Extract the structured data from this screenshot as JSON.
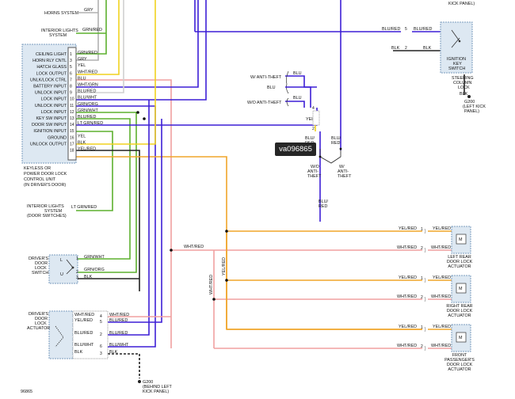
{
  "image_ref": "96865",
  "stamp": "va096865",
  "top_right_frag": "KICK PANEL)",
  "left_systems": {
    "horns": "HORNS SYSTEM",
    "horns_wire": "GRY",
    "interior_1": "INTERIOR LIGHTS",
    "interior_2": "SYSTEM",
    "interior_wire": "GRN/RED"
  },
  "module": {
    "caption": [
      "KEYLESS OR",
      "POWER DOOR LOCK",
      "CONTROL UNIT",
      "(IN DRIVER'S DOOR)"
    ],
    "pins": [
      {
        "n": "1",
        "label": "CEILING LIGHT",
        "wire": "GRN/RED"
      },
      {
        "n": "3",
        "label": "HORN RLY CNTL",
        "wire": "GRY"
      },
      {
        "n": "5",
        "label": "HATCH GLASS",
        "wire": "YEL"
      },
      {
        "n": "6",
        "label": "LOCK OUTPUT",
        "wire": "WHT/RED"
      },
      {
        "n": "7",
        "label": "UNLK/LOCK CTRL",
        "wire": "BLU"
      },
      {
        "n": "8",
        "label": "BATTERY INPUT",
        "wire": "WHT/GRN"
      },
      {
        "n": "9",
        "label": "UNLOCK INPUT",
        "wire": "BLU/RED"
      },
      {
        "n": "10",
        "label": "LOCK INPUT",
        "wire": "BLU/WHT"
      },
      {
        "n": "11",
        "label": "UNLOCK INPUT",
        "wire": "GRN/ORG"
      },
      {
        "n": "12",
        "label": "LOCK INPUT",
        "wire": "GRN/WHT"
      },
      {
        "n": "13",
        "label": "KEY SW INPUT",
        "wire": "BLU/RED"
      },
      {
        "n": "14",
        "label": "DOOR SW INPUT",
        "wire": "LT GRN/RED"
      },
      {
        "n": "15",
        "label": "IGNITION INPUT",
        "wire": ""
      },
      {
        "n": "16",
        "label": "GROUND",
        "wire": "YEL"
      },
      {
        "n": "17",
        "label": "UNLOCK OUTPUT",
        "wire": "BLK"
      },
      {
        "n": "18",
        "label": "",
        "wire": "YEL/RED"
      }
    ]
  },
  "interior_door": {
    "l1": "INTERIOR LIGHTS",
    "l2": "SYSTEM",
    "l3": "(DOOR SWITCHES)",
    "wire": "LT GRN/RED"
  },
  "door_lock_switch": {
    "l1": "DRIVER'S",
    "l2": "DOOR",
    "l3": "LOCK",
    "l4": "SWITCH",
    "L": "L",
    "U": "U",
    "pins": [
      "1",
      "2",
      "3"
    ],
    "wires": [
      "GRN/WHT",
      "GRN/ORG",
      "BLK"
    ]
  },
  "door_lock_actuator": {
    "l1": "DRIVER'S",
    "l2": "DOOR",
    "l3": "LOCK",
    "l4": "ACTUATOR",
    "left_wires": [
      "WHT/RED",
      "YEL/RED",
      "BLU/RED",
      "BLU/WHT",
      "BLK"
    ],
    "pins": [
      "4",
      "5",
      "2",
      "6",
      "3"
    ],
    "right_wires": [
      "WHT/RED",
      "BLU/RED",
      "BLU/RED",
      "BLU/WHT",
      "BLK"
    ]
  },
  "g200_bottom": {
    "l1": "G200",
    "l2": "(BEHIND LEFT",
    "l3": "KICK PANEL)"
  },
  "anti_theft": {
    "blu_top": "BLU",
    "w_label": "W/ ANTI-THEFT",
    "blu_mid": "BLU",
    "blu_low": "BLU",
    "wo_label": "W/O ANTI-THEFT",
    "pin4": "4",
    "yel": "YEL",
    "pin2": "2",
    "blu_red_1": "BLU/",
    "blu_red_1b": "RED",
    "blu_red_2": "BLU/",
    "blu_red_2b": "RED",
    "wo_col": [
      "W/O",
      "ANTI-",
      "THEFT"
    ],
    "w_col": [
      "W/",
      "ANTI-",
      "THEFT"
    ],
    "blu_red_3": "BLU/",
    "blu_red_3b": "RED"
  },
  "ignition": {
    "wire_in": "BLU/RED",
    "pin5": "5",
    "wire_out": "BLU/RED",
    "blk_left": "BLK",
    "pin2": "2",
    "blk_right": "BLK",
    "box": [
      "IGNITION",
      "KEY",
      "SWITCH"
    ],
    "col": [
      "STEERING",
      "COLUMN",
      "LOCK"
    ],
    "blk_gnd": "BLK",
    "g200": [
      "G200",
      "(LEFT KICK",
      "PANEL)"
    ]
  },
  "right_actuators": {
    "wht_red_bus": "WHT/RED",
    "yel_red_bus": "YEL/RED",
    "wht_red_vert": "WHT/RED",
    "rows": [
      {
        "l_top": "YEL/RED",
        "p_top": "1",
        "r_top": "YEL/RED",
        "l_bot": "WHT/RED",
        "p_bot": "2",
        "r_bot": "WHT/RED",
        "name": [
          "LEFT REAR",
          "DOOR LOCK",
          "ACTUATOR"
        ]
      },
      {
        "l_top": "YEL/RED",
        "p_top": "1",
        "r_top": "YEL/RED",
        "l_bot": "WHT/RED",
        "p_bot": "2",
        "r_bot": "WHT/RED",
        "name": [
          "RIGHT REAR",
          "DOOR LOCK",
          "ACTUATOR"
        ]
      },
      {
        "l_top": "YEL/RED",
        "p_top": "1",
        "r_top": "YEL/RED",
        "l_bot": "WHT/RED",
        "p_bot": "2",
        "r_bot": "WHT/RED",
        "name": [
          "FRONT",
          "PASSENGER'S",
          "DOOR LOCK",
          "ACTUATOR"
        ]
      }
    ],
    "motor": "M"
  },
  "colors": {
    "grn": "#5db12f",
    "yel": "#f0d21f",
    "blu": "#3d1fd6",
    "pink": "#f0a0a0",
    "yelred": "#f0a52a",
    "gry": "#b0b0b0",
    "wht": "#d8d8d8",
    "blk": "#222222",
    "box": "#dde8f2"
  }
}
